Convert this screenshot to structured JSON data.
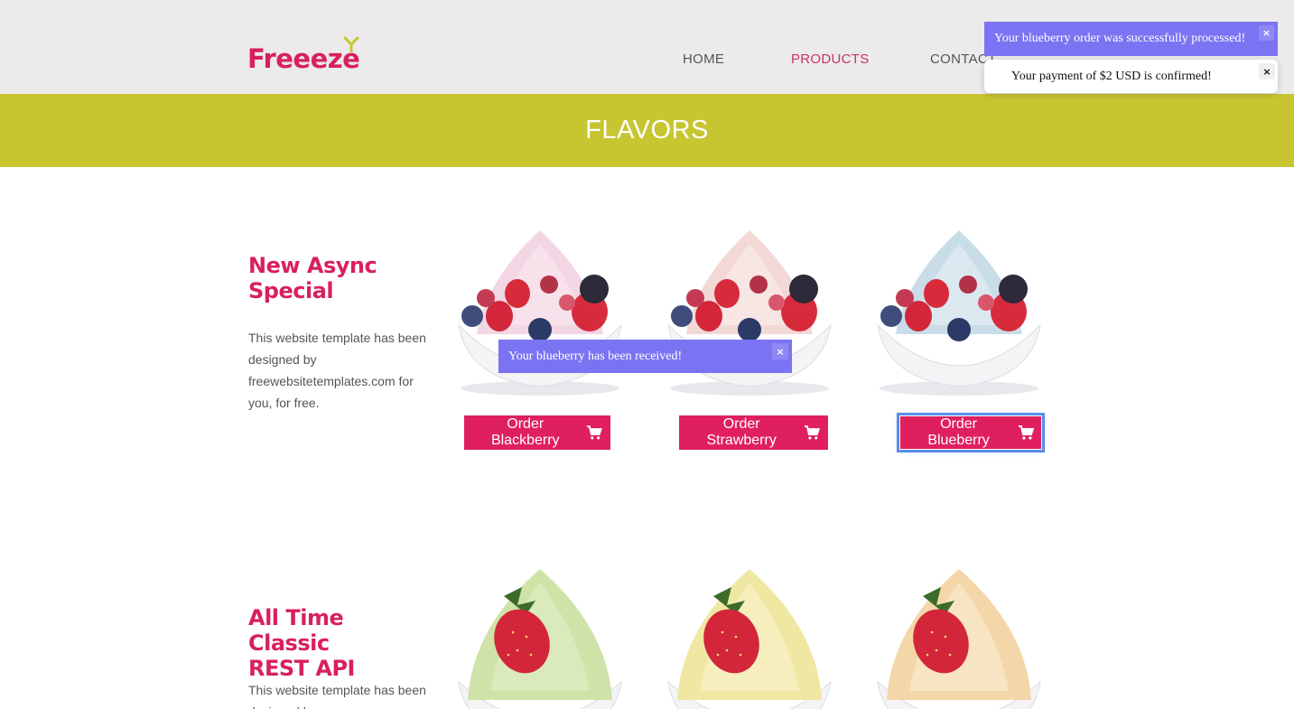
{
  "header": {
    "logo_text": "Freeeze",
    "nav": [
      "HOME",
      "PRODUCTS",
      "CONTACT"
    ],
    "active_nav": "PRODUCTS"
  },
  "band": {
    "title": "FLAVORS"
  },
  "sections": [
    {
      "title_line1": "New Async",
      "title_line2": "Special",
      "description": "This website template has been designed by freewebsitetemplates.com for you, for free.",
      "buttons": [
        "Order Blackberry",
        "Order Strawberry",
        "Order Blueberry"
      ]
    },
    {
      "title_line1": "All Time Classic",
      "title_line2": "REST API",
      "description": "This website template has been designed by"
    }
  ],
  "toasts": {
    "order_processed": "Your blueberry order was successfully processed!",
    "payment_confirmed": "Your payment of $2 USD is confirmed!",
    "received": "Your blueberry has been received!",
    "close_symbol": "×"
  },
  "icons": {
    "cart": "shopping-cart-icon",
    "close": "close-icon"
  },
  "colors": {
    "brand": "#d8205f",
    "band": "#c7c530",
    "button": "#e01f5f",
    "toast_purple": "#7b74f2",
    "focus_ring": "#5a8ce8"
  }
}
